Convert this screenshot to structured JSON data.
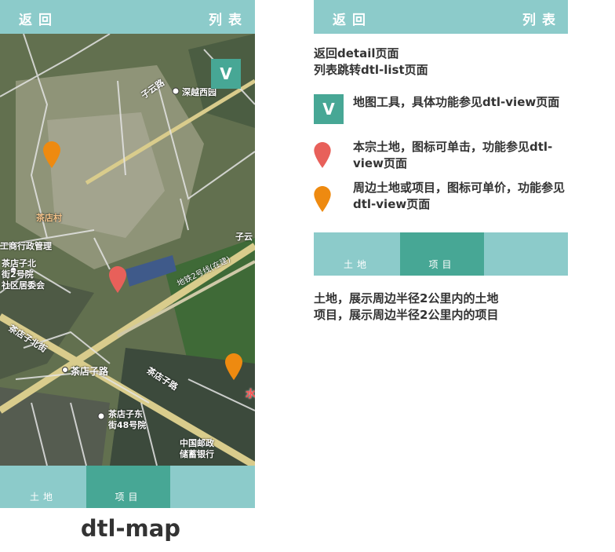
{
  "phone": {
    "header": {
      "back_label": "返回",
      "list_label": "列表"
    },
    "map_tool_label": "V",
    "map_labels": {
      "poi_top": "深越西园",
      "road_ziyun": "子云路",
      "village": "茶店村",
      "admin": "工商行政管理",
      "community": "茶店子北\n街2号院\n社区居委会",
      "road_main": "茶店子路",
      "road_north": "茶店子北街",
      "road_cross": "茶店子路",
      "road_diag": "地铁2号线(在建)",
      "poi_east": "茶店子东\n街48号院",
      "bank": "中国邮政\n储蓄银行",
      "road_right": "子云",
      "edge_red": "水"
    },
    "tabs": [
      {
        "label": "土地",
        "active": false
      },
      {
        "label": "项目",
        "active": true
      }
    ]
  },
  "caption": "dtl-map",
  "annotations": {
    "header": {
      "back_label": "返回",
      "list_label": "列表"
    },
    "nav_note_line1": "返回detail页面",
    "nav_note_line2": "列表跳转dtl-list页面",
    "tool_icon_label": "V",
    "tool_note": "地图工具，具体功能参见dtl-view页面",
    "red_pin_note": "本宗土地，图标可单击，功能参见dtl-view页面",
    "orange_pin_note": "周边土地或项目，图标可单价，功能参见dtl-view页面",
    "tabs": [
      {
        "label": "土地",
        "active": false
      },
      {
        "label": "项目",
        "active": true
      }
    ],
    "tab_note_line1": "土地，展示周边半径2公里内的土地",
    "tab_note_line2": "项目，展示周边半径2公里内的项目"
  },
  "colors": {
    "bar": "#8ccbca",
    "accent": "#47a795",
    "pin_red": "#e8605a",
    "pin_orange": "#ee8a10"
  }
}
